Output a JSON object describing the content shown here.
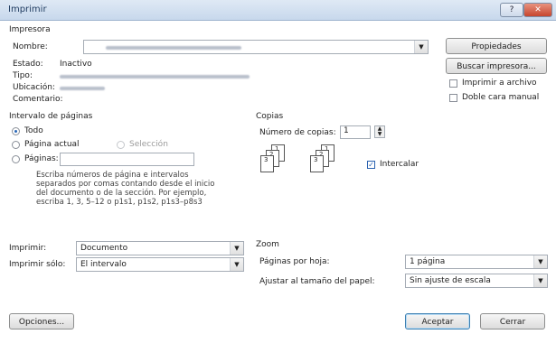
{
  "window": {
    "title": "Imprimir",
    "help": "?",
    "close": "✕"
  },
  "printer": {
    "section": "Impresora",
    "name_label": "Nombre:",
    "status_label": "Estado:",
    "status_value": "Inactivo",
    "type_label": "Tipo:",
    "location_label": "Ubicación:",
    "comment_label": "Comentario:",
    "properties_button": "Propiedades",
    "find_button": "Buscar impresora...",
    "print_to_file": "Imprimir a archivo",
    "manual_duplex": "Doble cara manual"
  },
  "page_range": {
    "section": "Intervalo de páginas",
    "all": "Todo",
    "current": "Página actual",
    "selection": "Selección",
    "pages": "Páginas:",
    "pages_value": "",
    "help_lines": [
      "Escriba números de página e intervalos",
      "separados por comas contando desde el inicio",
      "del documento o de la sección. Por ejemplo,",
      "escriba 1, 3, 5–12 o p1s1, p1s2, p1s3–p8s3"
    ]
  },
  "copies": {
    "section": "Copias",
    "count_label": "Número de copias:",
    "count_value": "1",
    "collate": "Intercalar",
    "page_icons": [
      "1",
      "2",
      "3",
      "1",
      "2",
      "3"
    ]
  },
  "print_what": {
    "label": "Imprimir:",
    "value": "Documento"
  },
  "print_only": {
    "label": "Imprimir sólo:",
    "value": "El intervalo"
  },
  "zoom": {
    "section": "Zoom",
    "pages_per_sheet_label": "Páginas por hoja:",
    "pages_per_sheet_value": "1 página",
    "scale_label": "Ajustar al tamaño del papel:",
    "scale_value": "Sin ajuste de escala"
  },
  "footer": {
    "options": "Opciones...",
    "ok": "Aceptar",
    "cancel": "Cerrar"
  },
  "colors": {
    "accent": "#2a68b8",
    "title_bg": "#c7d8ec",
    "close": "#c6452e"
  }
}
